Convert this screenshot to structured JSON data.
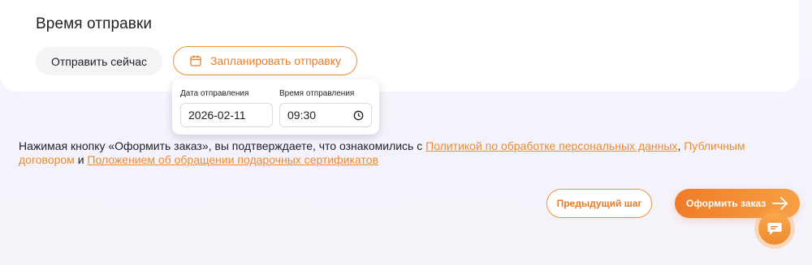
{
  "send_time": {
    "title": "Время отправки",
    "send_now_label": "Отправить сейчас",
    "schedule_label": "Запланировать отправку"
  },
  "schedule_popover": {
    "date_label": "Дата отправления",
    "date_value": "2026-02-11",
    "time_label": "Время отправления",
    "time_value": "09:30"
  },
  "consent": {
    "text_before": "Нажимая кнопку «Оформить заказ», вы подтверждаете, что ознакомились с ",
    "link_privacy": "Политикой по обработке персональных данных",
    "sep1": ", ",
    "link_offer": "Публичным договором",
    "sep2": " и ",
    "link_certificates": "Положением об обращении подарочных сертификатов"
  },
  "actions": {
    "prev_label": "Предыдущий шаг",
    "submit_label": "Оформить заказ"
  },
  "icons": {
    "calendar": "calendar-icon",
    "clock": "clock-icon",
    "arrow": "arrow-right-icon",
    "chat": "chat-icon"
  },
  "colors": {
    "accent": "#ef8a2c",
    "accent_dark": "#f07b28",
    "text": "#1f1f24",
    "background": "#f6f4fb"
  }
}
